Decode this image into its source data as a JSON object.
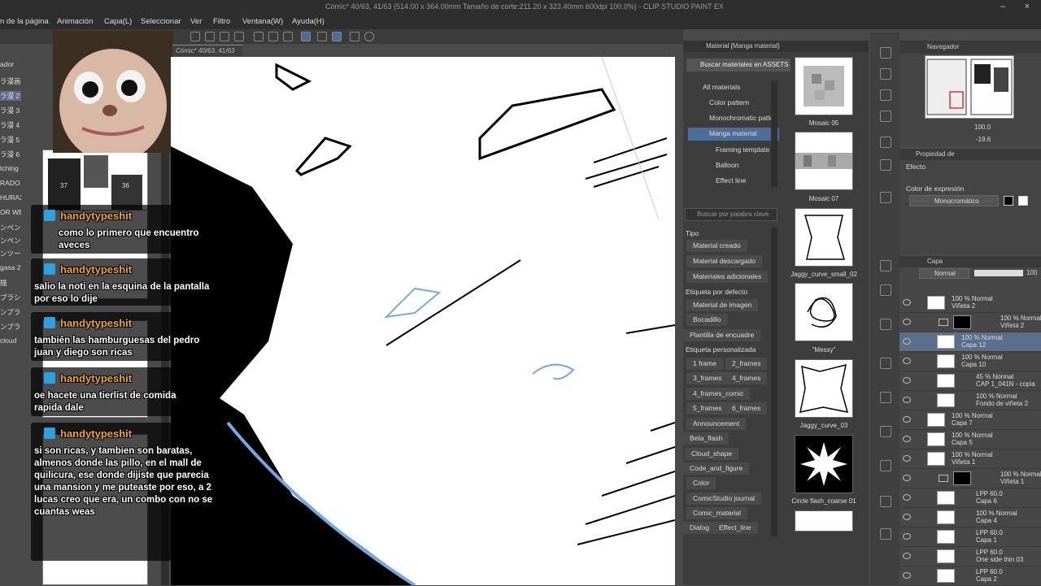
{
  "app": {
    "title": "Cómic* 40/63, 41/63 (514.00 x 364.00mm Tamaño de corte:211.20 x 323.40mm 600dpi 100.0%) - CLIP STUDIO PAINT EX",
    "canvas_tab": "Cómic* 40/63, 41/63"
  },
  "menu": [
    "n de la página",
    "Animación",
    "Capa(L)",
    "Seleccionar",
    "Ver",
    "Filtro",
    "Ventana(W)",
    "Ayuda(H)"
  ],
  "left_panel": {
    "labels": [
      "ador",
      "ラ漫画",
      "ラ漫 2",
      "ラ漫 3",
      "ラ漫 4",
      "ラ漫 5",
      "ラ漫 6",
      "tching",
      "RADO",
      "HURA2",
      "OR WE",
      "ンペン",
      "ンペン",
      "ンツール",
      "gasa 2",
      "描",
      "プラシ",
      "ンプラシ",
      "ンプラシ",
      "cloud"
    ],
    "page_numbers": [
      "37",
      "36"
    ]
  },
  "chat": [
    {
      "user": "handytypeshit",
      "message": "como lo primero que encuentro aveces"
    },
    {
      "user": "handytypeshit",
      "message": "salio la noti en la esquina de la pantalla por eso lo dije"
    },
    {
      "user": "handytypeshit",
      "message": "también las hamburguesas del pedro juan y diego son ricas"
    },
    {
      "user": "handytypeshit",
      "message": "oe hacete una tierlist de comida rapida dale"
    },
    {
      "user": "handytypeshit",
      "message": "si son ricas, y tambien son baratas, almenos donde las pillo, en el mall de quilicura, ese donde dijiste que parecia una mansion y me puteaste por eso, a 2 lucas creo que era, un combo con no se cuantas weas"
    }
  ],
  "material_panel": {
    "header": "Material [Manga material]",
    "assets_button": "Buscar materiales en ASSETS",
    "tree": [
      "All materials",
      "Color pattern",
      "Monochromatic patte",
      "Manga material",
      "Framing template",
      "Balloon",
      "Effect line"
    ],
    "search_placeholder": "Buscar por palabra clave",
    "tipo_heading": "Tipo",
    "tipo_tags": [
      "Material creado",
      "Material descargado",
      "Materiales adicionales"
    ],
    "default_heading": "Etiqueta por defecto",
    "default_tags": [
      "Material de imagen",
      "Bocadillo",
      "Plantilla de encuadre"
    ],
    "custom_heading": "Etiqueta personalizada",
    "custom_tags": [
      "1 frame",
      "2_frames",
      "3_frames",
      "4_frames",
      "4_frames_comic",
      "5_frames",
      "6_frames",
      "Announcement",
      "Beta_flash",
      "Cloud_shape",
      "Code_and_figure",
      "Color",
      "ComicStudio journal",
      "Comic_material",
      "Dialog",
      "Effect_line"
    ],
    "thumbnails": [
      "Mosaic 05",
      "Mosaic 07",
      "Jaggy_curve_small_02",
      "\"Messy\"",
      "Jaggy_curve_03",
      "Circle flash_coarse 01"
    ]
  },
  "navigator": {
    "title": "Navegador",
    "zoom": "100.0",
    "rotation": "-19.6"
  },
  "properties": {
    "title": "Propiedad de",
    "effect_label": "Efecto",
    "color_expr_label": "Color de expresión",
    "color_expr_value": "Monocromático"
  },
  "layers": {
    "title": "Capa",
    "blend_mode": "Normal",
    "opacity": "100",
    "rows": [
      {
        "l1": "100 % Normal",
        "l2": "Viñeta 2",
        "type": "layer"
      },
      {
        "l1": "100 % Normal",
        "l2": "Viñeta 2",
        "type": "folder"
      },
      {
        "l1": "100 % Normal",
        "l2": "Capa 12",
        "type": "layer",
        "selected": true
      },
      {
        "l1": "100 % Normal",
        "l2": "Capa 10",
        "type": "layer"
      },
      {
        "l1": "45 % Normal",
        "l2": "CAP 1_041N - copia",
        "type": "layer"
      },
      {
        "l1": "100 % Normal",
        "l2": "Fondo de viñeta 2",
        "type": "layer"
      },
      {
        "l1": "100 % Normal",
        "l2": "Capa 7",
        "type": "layer"
      },
      {
        "l1": "100 % Normal",
        "l2": "Capa 5",
        "type": "layer"
      },
      {
        "l1": "100 % Normal",
        "l2": "Viñeta 1",
        "type": "layer"
      },
      {
        "l1": "100 % Normal",
        "l2": "Viñeta 1",
        "type": "folder"
      },
      {
        "l1": "LPP 60.0",
        "l2": "Capa 6",
        "type": "layer"
      },
      {
        "l1": "100 % Normal",
        "l2": "Capa 4",
        "type": "layer"
      },
      {
        "l1": "LPP 60.0",
        "l2": "Capa 1",
        "type": "layer"
      },
      {
        "l1": "LPP 60.0",
        "l2": "One side thin 03",
        "type": "layer"
      },
      {
        "l1": "LPP 60.0",
        "l2": "Capa 2",
        "type": "layer"
      }
    ]
  }
}
